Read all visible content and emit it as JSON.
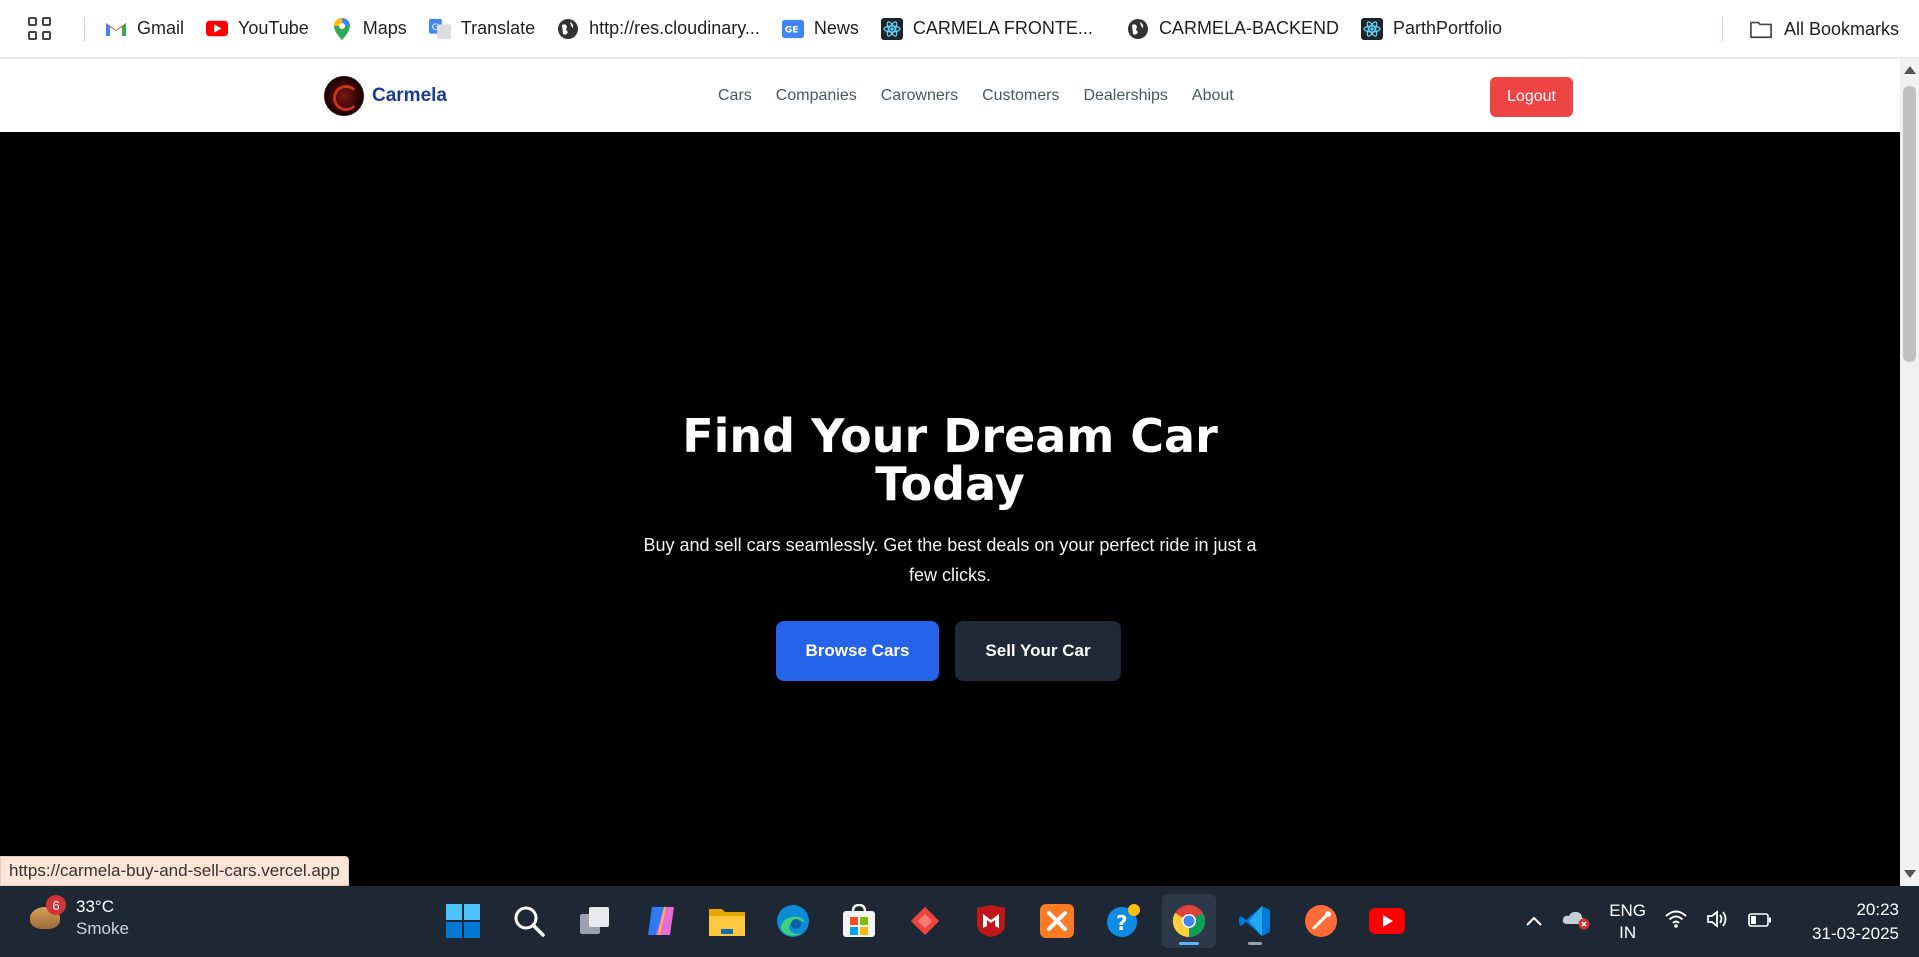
{
  "bookmarks": {
    "items": [
      {
        "label": "Gmail",
        "icon": "gmail-icon"
      },
      {
        "label": "YouTube",
        "icon": "youtube-icon"
      },
      {
        "label": "Maps",
        "icon": "maps-icon"
      },
      {
        "label": "Translate",
        "icon": "translate-icon"
      },
      {
        "label": "http://res.cloudinary...",
        "icon": "globe-icon"
      },
      {
        "label": "News",
        "icon": "news-icon"
      },
      {
        "label": "CARMELA FRONTE...",
        "icon": "react-icon"
      },
      {
        "label": "CARMELA-BACKEND",
        "icon": "globe-icon"
      },
      {
        "label": "ParthPortfolio",
        "icon": "react-icon"
      }
    ],
    "all_bookmarks": "All Bookmarks"
  },
  "site": {
    "brand": "Carmela",
    "nav": [
      "Cars",
      "Companies",
      "Carowners",
      "Customers",
      "Dealerships",
      "About"
    ],
    "logout": "Logout"
  },
  "hero": {
    "title": "Find Your Dream Car Today",
    "subtitle": "Buy and sell cars seamlessly. Get the best deals on your perfect ride in just a few clicks.",
    "primary_button": "Browse Cars",
    "secondary_button": "Sell Your Car"
  },
  "status_url": "https://carmela-buy-and-sell-cars.vercel.app",
  "taskbar": {
    "weather_badge": "6",
    "temperature": "33°C",
    "condition": "Smoke",
    "apps": [
      "windows-start",
      "search",
      "task-view",
      "copilot",
      "file-explorer",
      "edge",
      "microsoft-store",
      "anydesk",
      "mcafee",
      "xampp",
      "help",
      "chrome",
      "vscode",
      "postman",
      "youtube"
    ],
    "lang_line1": "ENG",
    "lang_line2": "IN",
    "time": "20:23",
    "date": "31-03-2025"
  },
  "colors": {
    "brand_blue": "#1d3a8f",
    "logout_red": "#ef4444",
    "browse_blue": "#2563eb",
    "sell_dark": "#1f2937",
    "taskbar": "#1e2734"
  }
}
